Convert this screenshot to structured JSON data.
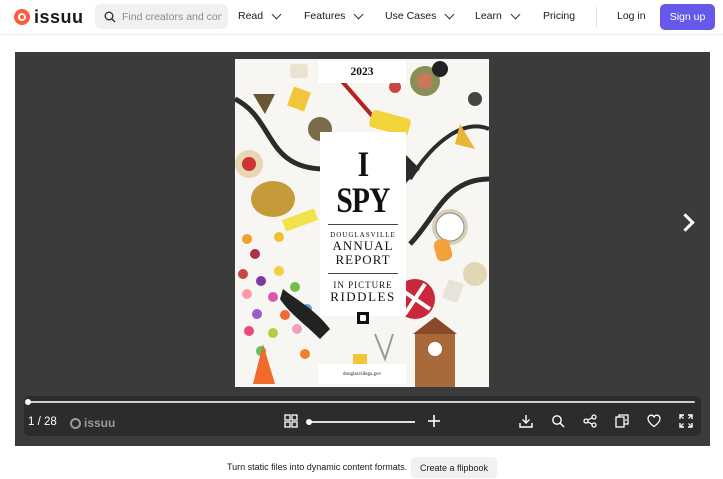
{
  "header": {
    "logo_text": "issuu",
    "search_placeholder": "Find creators and content",
    "nav": [
      {
        "label": "Read"
      },
      {
        "label": "Features"
      },
      {
        "label": "Use Cases"
      },
      {
        "label": "Learn"
      },
      {
        "label": "Pricing"
      }
    ],
    "login_label": "Log in",
    "signup_label": "Sign up"
  },
  "publication": {
    "year": "2023",
    "title_main": "I SPY",
    "title_line1": "DOUGLASVILLE",
    "title_line2": "ANNUAL",
    "title_line3": "REPORT",
    "title_line4": "IN PICTURE",
    "title_line5": "RIDDLES",
    "url": "douglasvillega.gov"
  },
  "controls": {
    "page_indicator": "1 / 28",
    "brand": "issuu",
    "icons": [
      "grid-icon",
      "zoom-slider",
      "plus-icon",
      "download-icon",
      "search-icon",
      "share-icon",
      "embed-icon",
      "heart-icon",
      "fullscreen-icon"
    ]
  },
  "banner": {
    "text": "Turn static files into dynamic content formats.",
    "button_label": "Create a flipbook"
  },
  "colors": {
    "brand_orange": "#ff5a3c",
    "signup_purple": "#6658e8",
    "viewer_bg": "#3b3b3b",
    "control_bar": "#2c2c2c"
  }
}
